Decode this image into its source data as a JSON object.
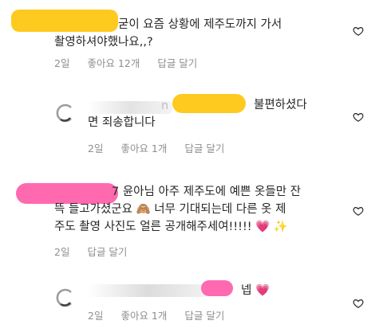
{
  "comments": [
    {
      "line1": "굳이 요즘 상황에 제주도까지 가서",
      "line2": "촬영하셔야했나요,,?",
      "time": "2일",
      "likes": "좋아요 12개",
      "reply": "답글 달기"
    },
    {
      "line1": "불편하셨다",
      "line2": "면 죄송합니다",
      "time": "2일",
      "likes": "좋아요 1개",
      "reply": "답글 달기",
      "username_tail": "n"
    },
    {
      "line1": "7 윤아님 아주 제주도에 예쁜 옷들만 잔",
      "line2": "뜩 들고가셨군요 🙈 너무 기대되는데 다른 옷 제",
      "line3": "주도 촬영 사진도 얼른 공개해주세여!!!!! 💗 ✨",
      "time": "2일",
      "reply": "답글 달기"
    },
    {
      "line1": "넵 💗",
      "time": "2일",
      "likes": "좋아요 1개",
      "reply": "답글 달기"
    }
  ],
  "icons": {
    "like": "heart-outline-icon",
    "avatar": "profile-avatar"
  },
  "colors": {
    "redact_yellow": "#ffca1f",
    "redact_pink": "#ff69b0",
    "meta_gray": "#8e8e8e"
  }
}
